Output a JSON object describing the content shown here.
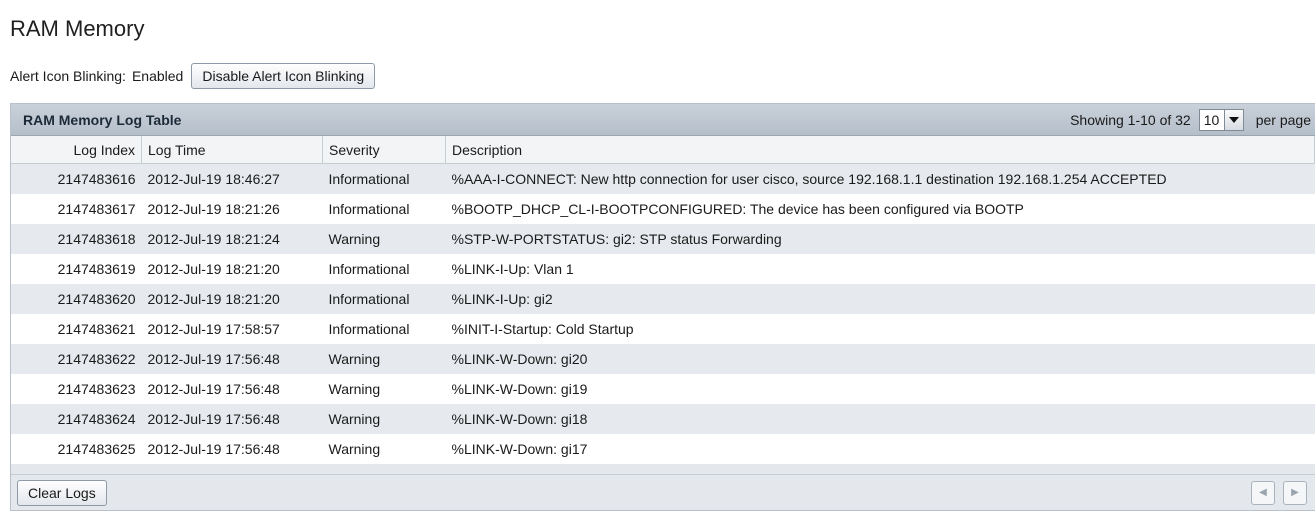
{
  "page": {
    "title": "RAM Memory"
  },
  "alert": {
    "label": "Alert Icon Blinking:",
    "value": "Enabled",
    "button_label": "Disable Alert Icon Blinking"
  },
  "table": {
    "title": "RAM Memory Log Table",
    "showing_text": "Showing 1-10 of 32",
    "per_page_value": "10",
    "per_page_label": "per page",
    "columns": [
      "Log Index",
      "Log Time",
      "Severity",
      "Description"
    ],
    "rows": [
      [
        "2147483616",
        "2012-Jul-19 18:46:27",
        "Informational",
        "%AAA-I-CONNECT: New http connection for user cisco, source 192.168.1.1 destination 192.168.1.254 ACCEPTED"
      ],
      [
        "2147483617",
        "2012-Jul-19 18:21:26",
        "Informational",
        "%BOOTP_DHCP_CL-I-BOOTPCONFIGURED: The device has been configured via BOOTP"
      ],
      [
        "2147483618",
        "2012-Jul-19 18:21:24",
        "Warning",
        "%STP-W-PORTSTATUS: gi2: STP status Forwarding"
      ],
      [
        "2147483619",
        "2012-Jul-19 18:21:20",
        "Informational",
        "%LINK-I-Up:  Vlan 1"
      ],
      [
        "2147483620",
        "2012-Jul-19 18:21:20",
        "Informational",
        "%LINK-I-Up:  gi2"
      ],
      [
        "2147483621",
        "2012-Jul-19 17:58:57",
        "Informational",
        "%INIT-I-Startup: Cold Startup"
      ],
      [
        "2147483622",
        "2012-Jul-19 17:56:48",
        "Warning",
        "%LINK-W-Down:  gi20"
      ],
      [
        "2147483623",
        "2012-Jul-19 17:56:48",
        "Warning",
        "%LINK-W-Down:  gi19"
      ],
      [
        "2147483624",
        "2012-Jul-19 17:56:48",
        "Warning",
        "%LINK-W-Down:  gi18"
      ],
      [
        "2147483625",
        "2012-Jul-19 17:56:48",
        "Warning",
        "%LINK-W-Down:  gi17"
      ]
    ],
    "clear_button_label": "Clear Logs",
    "prev_icon": "chevron-left-icon",
    "next_icon": "chevron-right-icon"
  }
}
